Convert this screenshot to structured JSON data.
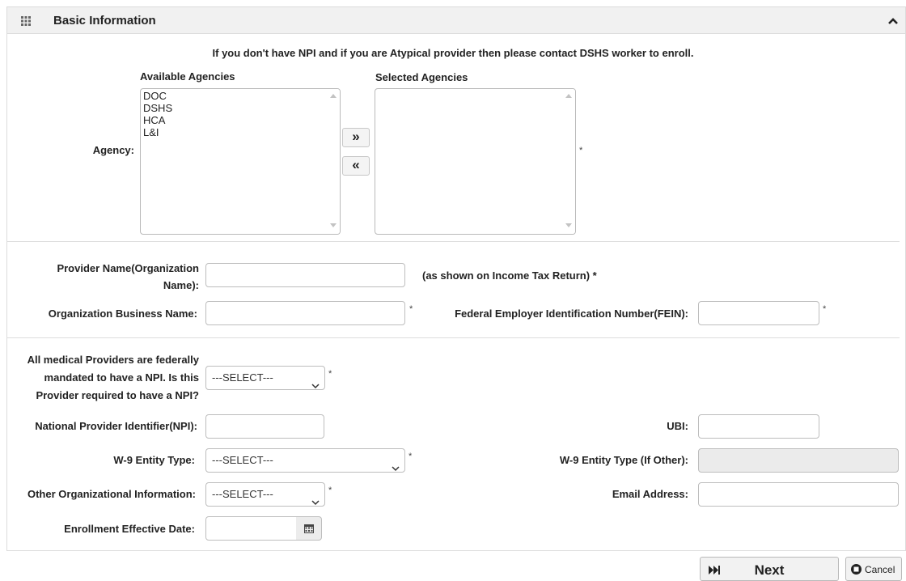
{
  "panel": {
    "title": "Basic Information"
  },
  "notice": "If you don't have NPI and if you are Atypical provider then please contact DSHS worker to enroll.",
  "agency": {
    "label": "Agency:",
    "available_header": "Available Agencies",
    "selected_header": "Selected Agencies",
    "available": [
      "DOC",
      "DSHS",
      "HCA",
      "L&I"
    ],
    "selected": [],
    "add_label": "»",
    "remove_label": "«",
    "required_mark": "*"
  },
  "provider_name": {
    "label_line1": "Provider Name(Organization",
    "label_line2": "Name):",
    "value": "",
    "hint": "(as shown on Income Tax Return) *"
  },
  "org_business_name": {
    "label": "Organization Business Name:",
    "value": "",
    "required_mark": "*"
  },
  "fein": {
    "label": "Federal Employer Identification Number(FEIN):",
    "value": "",
    "required_mark": "*"
  },
  "npi_required": {
    "label_line1": "All medical Providers are federally",
    "label_line2": "mandated to have a NPI. Is this",
    "label_line3": "Provider required to have a NPI?",
    "selected": "---SELECT---",
    "required_mark": "*"
  },
  "npi": {
    "label": "National Provider Identifier(NPI):",
    "value": ""
  },
  "ubi": {
    "label": "UBI:",
    "value": ""
  },
  "w9_entity_type": {
    "label": "W-9 Entity Type:",
    "selected": "---SELECT---",
    "required_mark": "*"
  },
  "w9_entity_other": {
    "label": "W-9 Entity Type (If Other):",
    "value": ""
  },
  "other_org_info": {
    "label": "Other Organizational Information:",
    "selected": "---SELECT---",
    "required_mark": "*"
  },
  "email": {
    "label": "Email Address:",
    "value": ""
  },
  "enrollment_date": {
    "label": "Enrollment Effective Date:",
    "value": ""
  },
  "actions": {
    "next": "Next",
    "cancel": "Cancel"
  }
}
